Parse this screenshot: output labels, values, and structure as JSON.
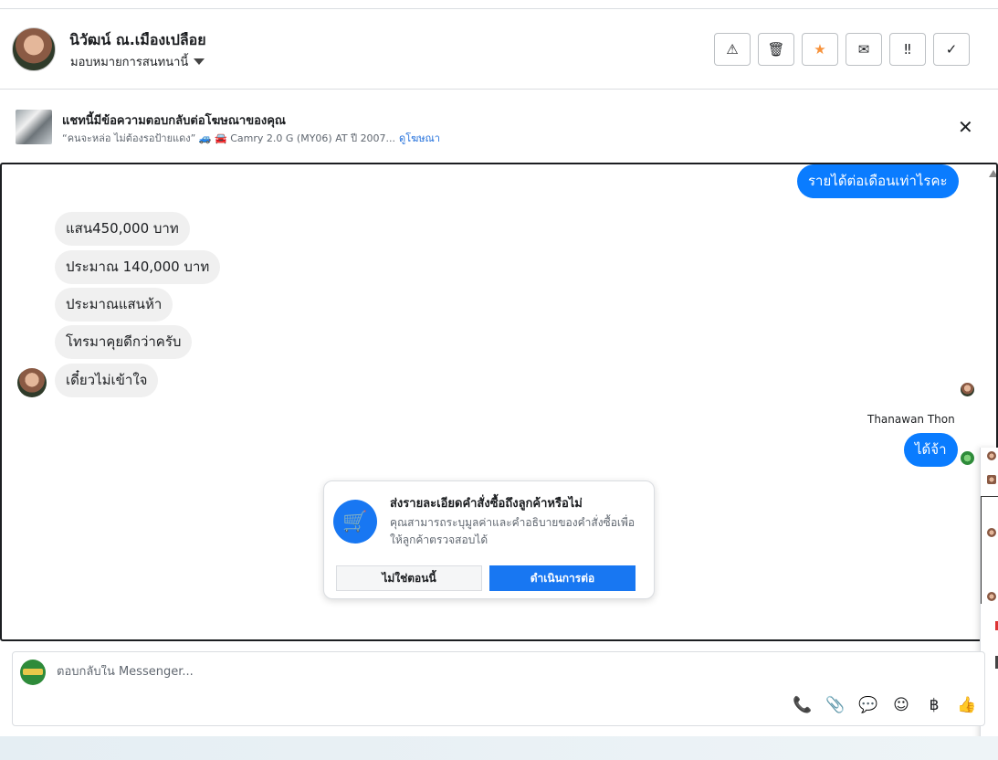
{
  "header": {
    "contact_name": "นิวัฒน์ ณ.เมืองเปลือย",
    "assign_label": "มอบหมายการสนทนานี้",
    "tools": [
      {
        "name": "spam-icon",
        "glyph": "⚠"
      },
      {
        "name": "delete-icon",
        "glyph": "🗑"
      },
      {
        "name": "star-icon",
        "glyph": "★"
      },
      {
        "name": "mail-icon",
        "glyph": "✉"
      },
      {
        "name": "follow-up-icon",
        "glyph": "‼"
      },
      {
        "name": "done-icon",
        "glyph": "✓"
      }
    ]
  },
  "ad_banner": {
    "title": "แชทนี้มีข้อความตอบกลับต่อโฆษณาของคุณ",
    "subtitle": "“คนจะหล่อ ไม่ต้องรอป้ายแดง” 🚙 🚘 Camry 2.0 G (MY06) AT ปี 2007...",
    "link": "ดูโฆษณา",
    "close_glyph": "✕"
  },
  "messages": {
    "m1": "รายได้ต่อเดือนเท่าไรคะ",
    "m2": "แสน450,000 บาท",
    "m3": "ประมาณ 140,000 บาท",
    "m4": "ประมาณแสนห้า",
    "m5": "โทรมาคุยดีกว่าครับ",
    "m6": "เดี๋ยวไม่เข้าใจ",
    "m7": "ได้จ้า",
    "sender_name": "Thanawan Thon"
  },
  "order_card": {
    "title": "ส่งรายละเอียดคำสั่งซื้อถึงลูกค้าหรือไม่",
    "description": "คุณสามารถระบุมูลค่าและคำอธิบายของคำสั่งซื้อเพื่อให้ลูกค้าตรวจสอบได้",
    "decline_label": "ไม่ใช่ตอนนี้",
    "continue_label": "ดำเนินการต่อ",
    "icon_glyph": "🛒"
  },
  "composer": {
    "placeholder": "ตอบกลับใน Messenger...",
    "tools": [
      {
        "name": "call-add-icon",
        "glyph": "📞"
      },
      {
        "name": "attach-icon",
        "glyph": "📎"
      },
      {
        "name": "saved-reply-icon",
        "glyph": "💬"
      },
      {
        "name": "emoji-icon",
        "glyph": "☺"
      },
      {
        "name": "baht-icon",
        "glyph": "฿"
      },
      {
        "name": "thumbs-up-icon",
        "glyph": "👍"
      }
    ]
  },
  "colors": {
    "accent": "#1877f2",
    "outgoing_bubble": "#0a7cff",
    "incoming_bubble": "#f0f0f0",
    "star": "#f7923b"
  }
}
